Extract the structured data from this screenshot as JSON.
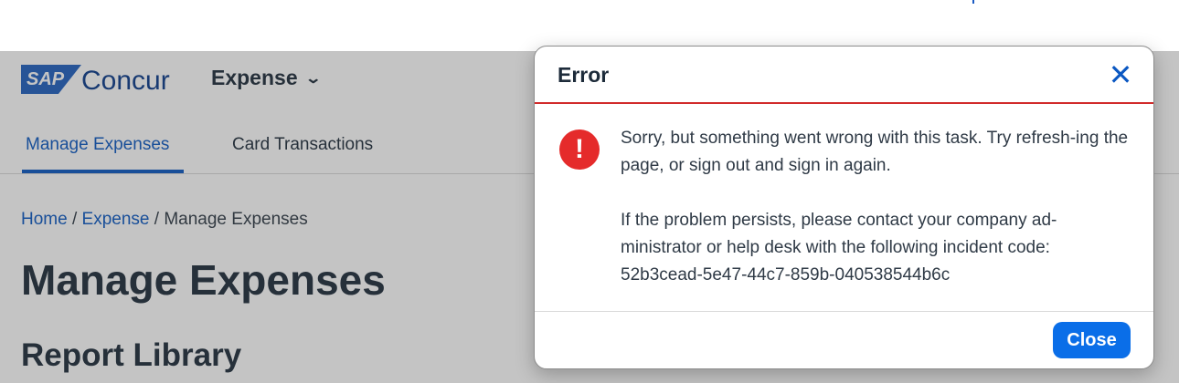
{
  "header": {
    "logo_badge": "SAP",
    "logo_name": "Concur",
    "module": "Expense",
    "module_icon": "chevron-down-icon"
  },
  "tabs": [
    {
      "label": "Manage Expenses",
      "active": true
    },
    {
      "label": "Card Transactions",
      "active": false
    }
  ],
  "breadcrumb": {
    "home": "Home",
    "expense": "Expense",
    "current": "Manage Expenses",
    "separator": "/"
  },
  "page": {
    "title": "Manage Expenses",
    "section": "Report Library"
  },
  "dialog": {
    "title": "Error",
    "close_icon": "close-icon",
    "error_icon": "exclamation-icon",
    "message_line1": "Sorry, but something went wrong with this task. Try refresh-ing the page, or sign out and sign in again.",
    "message_line2": "If the problem persists, please contact your company ad-ministrator or help desk with the following incident code: 52b3cead-5e47-44c7-859b-040538544b6c",
    "close_button": "Close"
  },
  "colors": {
    "accent": "#0b58c2",
    "error": "#e52b2b",
    "button": "#0a6ee8"
  }
}
